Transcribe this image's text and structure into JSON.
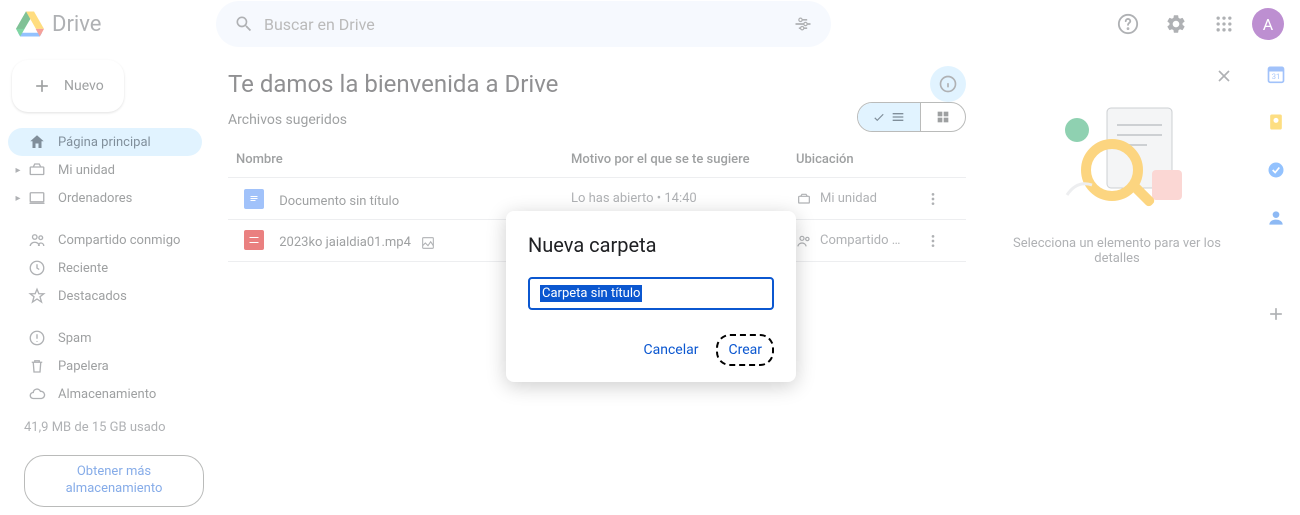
{
  "header": {
    "product_name": "Drive",
    "search_placeholder": "Buscar en Drive",
    "avatar_initial": "A"
  },
  "sidebar": {
    "new_label": "Nuevo",
    "items": [
      {
        "label": "Página principal"
      },
      {
        "label": "Mi unidad"
      },
      {
        "label": "Ordenadores"
      },
      {
        "label": "Compartido conmigo"
      },
      {
        "label": "Reciente"
      },
      {
        "label": "Destacados"
      },
      {
        "label": "Spam"
      },
      {
        "label": "Papelera"
      },
      {
        "label": "Almacenamiento"
      }
    ],
    "storage_text": "41,9 MB de 15 GB usado",
    "storage_cta": "Obtener más almacenamiento"
  },
  "main": {
    "welcome_title": "Te damos la bienvenida a Drive",
    "suggested_label": "Archivos sugeridos",
    "columns": {
      "name": "Nombre",
      "reason": "Motivo por el que se te sugiere",
      "location": "Ubicación"
    },
    "rows": [
      {
        "name": "Documento sin título",
        "reason": "Lo has abierto • 14:40",
        "location": "Mi unidad"
      },
      {
        "name": "2023ko jaialdia01.mp4",
        "reason": "",
        "location": "Compartido …"
      }
    ]
  },
  "details": {
    "empty_text": "Selecciona un elemento para ver los detalles"
  },
  "modal": {
    "title": "Nueva carpeta",
    "input_value": "Carpeta sin título",
    "cancel": "Cancelar",
    "create": "Crear"
  }
}
